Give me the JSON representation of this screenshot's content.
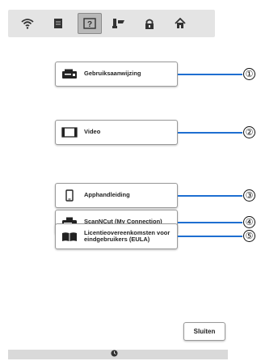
{
  "toolbar": {
    "icons": [
      "wifi-icon",
      "document-icon",
      "help-icon",
      "tools-icon",
      "lock-icon",
      "home-icon"
    ],
    "selected": "help-icon"
  },
  "menu": {
    "items": [
      {
        "label": "Gebruiksaanwijzing",
        "icon": "printer-icon",
        "callout": "①"
      },
      {
        "label": "Video",
        "icon": "film-icon",
        "callout": "②"
      },
      {
        "label": "Apphandleiding",
        "icon": "phone-icon",
        "callout": "③"
      },
      {
        "label": "ScanNCut (My Connection)",
        "icon": "cutting-machine-icon",
        "callout": "④"
      },
      {
        "label": "Licentieovereenkomsten voor eindgebruikers (EULA)",
        "icon": "book-icon",
        "callout": "⑤"
      }
    ]
  },
  "footer": {
    "close_label": "Sluiten",
    "status_icon": "clock-icon"
  },
  "colors": {
    "accent": "#1f6fd1",
    "toolbar_bg": "#e4e4e4",
    "selected_bg": "#b9b9b9"
  }
}
